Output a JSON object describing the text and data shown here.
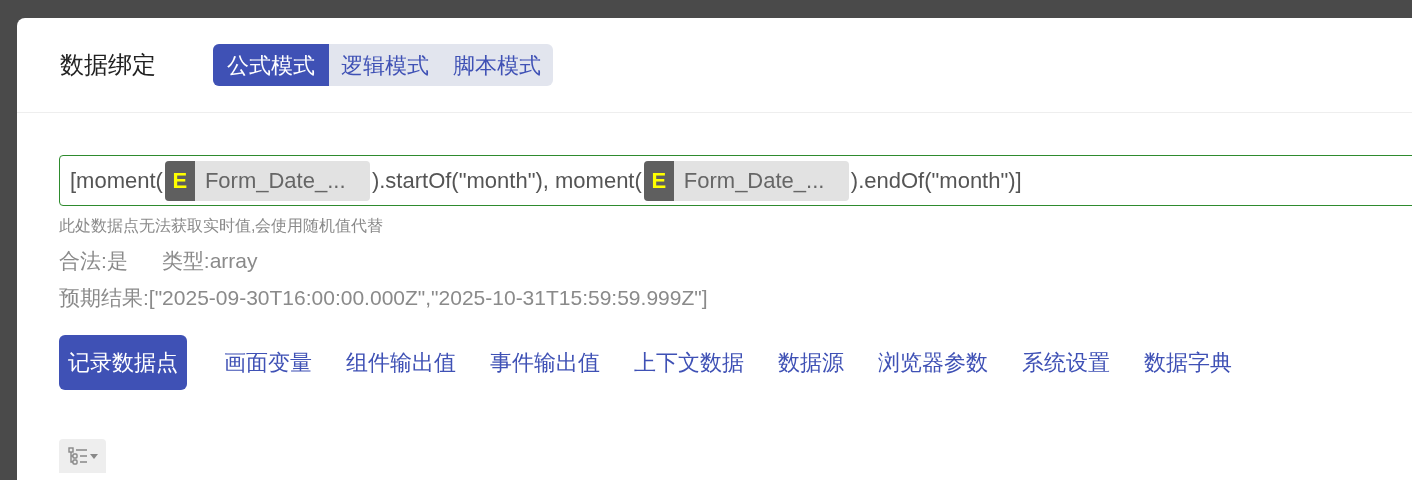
{
  "dialog": {
    "title": "数据绑定",
    "modes": [
      {
        "label": "公式模式",
        "selected": true
      },
      {
        "label": "逻辑模式",
        "selected": false
      },
      {
        "label": "脚本模式",
        "selected": false
      }
    ]
  },
  "formula": {
    "segments": [
      {
        "kind": "text",
        "text": "[moment("
      },
      {
        "kind": "chip",
        "badge": "E",
        "text": "Form_Date_..."
      },
      {
        "kind": "text",
        "text": ").startOf(\"month\"), moment("
      },
      {
        "kind": "chip",
        "badge": "E",
        "text": "Form_Date_..."
      },
      {
        "kind": "text",
        "text": ").endOf(\"month\")]"
      }
    ],
    "hint": "此处数据点无法获取实时值,会使用随机值代替",
    "valid": "合法:是",
    "type": "类型:array",
    "expected": "预期结果:[\"2025-09-30T16:00:00.000Z\",\"2025-10-31T15:59:59.999Z\"]"
  },
  "sources": [
    {
      "label": "记录数据点",
      "selected": true
    },
    {
      "label": "画面变量",
      "selected": false
    },
    {
      "label": "组件输出值",
      "selected": false
    },
    {
      "label": "事件输出值",
      "selected": false
    },
    {
      "label": "上下文数据",
      "selected": false
    },
    {
      "label": "数据源",
      "selected": false
    },
    {
      "label": "浏览器参数",
      "selected": false
    },
    {
      "label": "系统设置",
      "selected": false
    },
    {
      "label": "数据字典",
      "selected": false
    }
  ]
}
